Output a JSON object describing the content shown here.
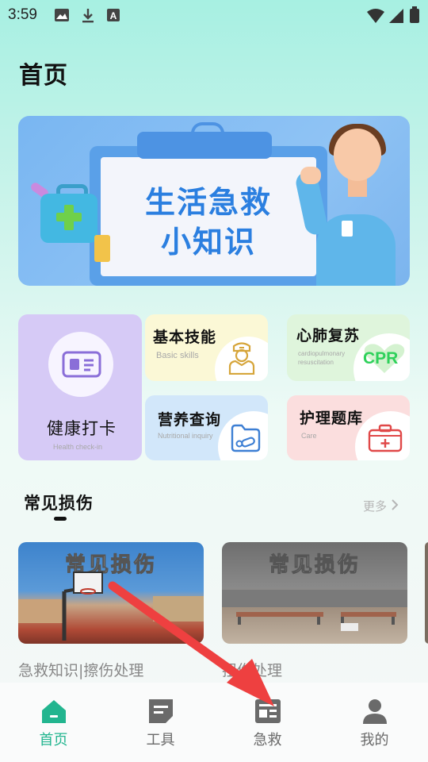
{
  "status_bar": {
    "time": "3:59"
  },
  "page": {
    "title": "首页"
  },
  "banner": {
    "line1": "生活急救",
    "line2": "小知识"
  },
  "features": [
    {
      "title": "健康打卡",
      "subtitle": "Health check-in"
    },
    {
      "title": "基本技能",
      "subtitle": "Basic skills"
    },
    {
      "title": "心肺复苏",
      "subtitle": "cardiopulmonary resuscitation",
      "badge": "CPR"
    },
    {
      "title": "营养查询",
      "subtitle": "Nutritional inquiry"
    },
    {
      "title": "护理题库",
      "subtitle": "Care"
    }
  ],
  "section": {
    "title": "常见损伤",
    "more": "更多 "
  },
  "articles": [
    {
      "headline": "常见损伤",
      "caption": "急救知识|擦伤处理"
    },
    {
      "headline": "常见损伤",
      "caption": "扭伤处理"
    }
  ],
  "nav": [
    {
      "label": "首页",
      "active": true
    },
    {
      "label": "工具",
      "active": false
    },
    {
      "label": "急救",
      "active": false
    },
    {
      "label": "我的",
      "active": false
    }
  ],
  "colors": {
    "accent": "#22b58f",
    "annotation_arrow": "#ee4040"
  }
}
